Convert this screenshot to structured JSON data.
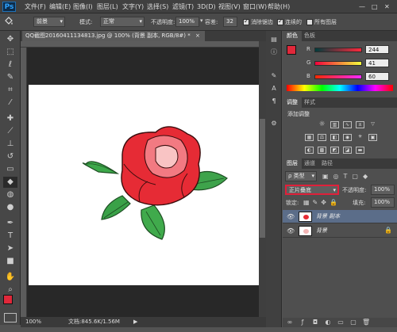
{
  "app": {
    "logo": "Ps"
  },
  "menu": [
    "文件(F)",
    "编辑(E)",
    "图像(I)",
    "图层(L)",
    "文字(Y)",
    "选择(S)",
    "滤镜(T)",
    "3D(D)",
    "视图(V)",
    "窗口(W)",
    "帮助(H)"
  ],
  "window_controls": {
    "minimize": "—",
    "maximize": "□",
    "close": "✕"
  },
  "options": {
    "tool_icon": "bucket-icon",
    "fill_source": "前景",
    "mode_label": "模式:",
    "mode_value": "正常",
    "opacity_label": "不透明度:",
    "opacity_value": "100%",
    "tolerance_label": "容差:",
    "tolerance_value": "32",
    "antialias_label": "消除锯齿",
    "contiguous_label": "连续的",
    "all_layers_label": "所有图层",
    "antialias_checked": true,
    "contiguous_checked": true,
    "all_layers_checked": false
  },
  "document": {
    "tab_title": "QQ截图20160411134813.jpg @ 100% (背景 副本, RGB/8#) *",
    "tab_close": "×",
    "zoom": "100%",
    "doc_info": "文档:845.6K/1.56M",
    "scroll_arrow": "▶"
  },
  "tools": [
    "move-icon",
    "marquee-icon",
    "lasso-icon",
    "quick-select-icon",
    "crop-icon",
    "eyedropper-icon",
    "healing-icon",
    "brush-icon",
    "clone-stamp-icon",
    "history-brush-icon",
    "eraser-icon",
    "bucket-icon",
    "blur-icon",
    "dodge-icon",
    "pen-icon",
    "type-icon",
    "path-select-icon",
    "shape-icon",
    "hand-icon",
    "zoom-icon"
  ],
  "colors": {
    "foreground": "#e0283a",
    "background": "#ffffff",
    "accent_red_box": "#e0203a"
  },
  "color_panel": {
    "tabs": [
      "颜色",
      "色板"
    ],
    "channels": [
      {
        "label": "R",
        "value": "244"
      },
      {
        "label": "G",
        "value": "41"
      },
      {
        "label": "B",
        "value": "60"
      }
    ]
  },
  "adjustments_panel": {
    "tabs": [
      "调整",
      "样式"
    ],
    "title": "添加调整"
  },
  "layers_panel": {
    "tabs": [
      "图层",
      "通道",
      "路径"
    ],
    "filter_label": "ρ 类型",
    "blend_mode": "正片叠底",
    "opacity_label": "不透明度:",
    "opacity_value": "100%",
    "lock_label": "锁定:",
    "fill_label": "填充:",
    "fill_value": "100%",
    "layers": [
      {
        "name": "背景 副本",
        "selected": true
      },
      {
        "name": "背景",
        "selected": false,
        "locked": true
      }
    ]
  }
}
